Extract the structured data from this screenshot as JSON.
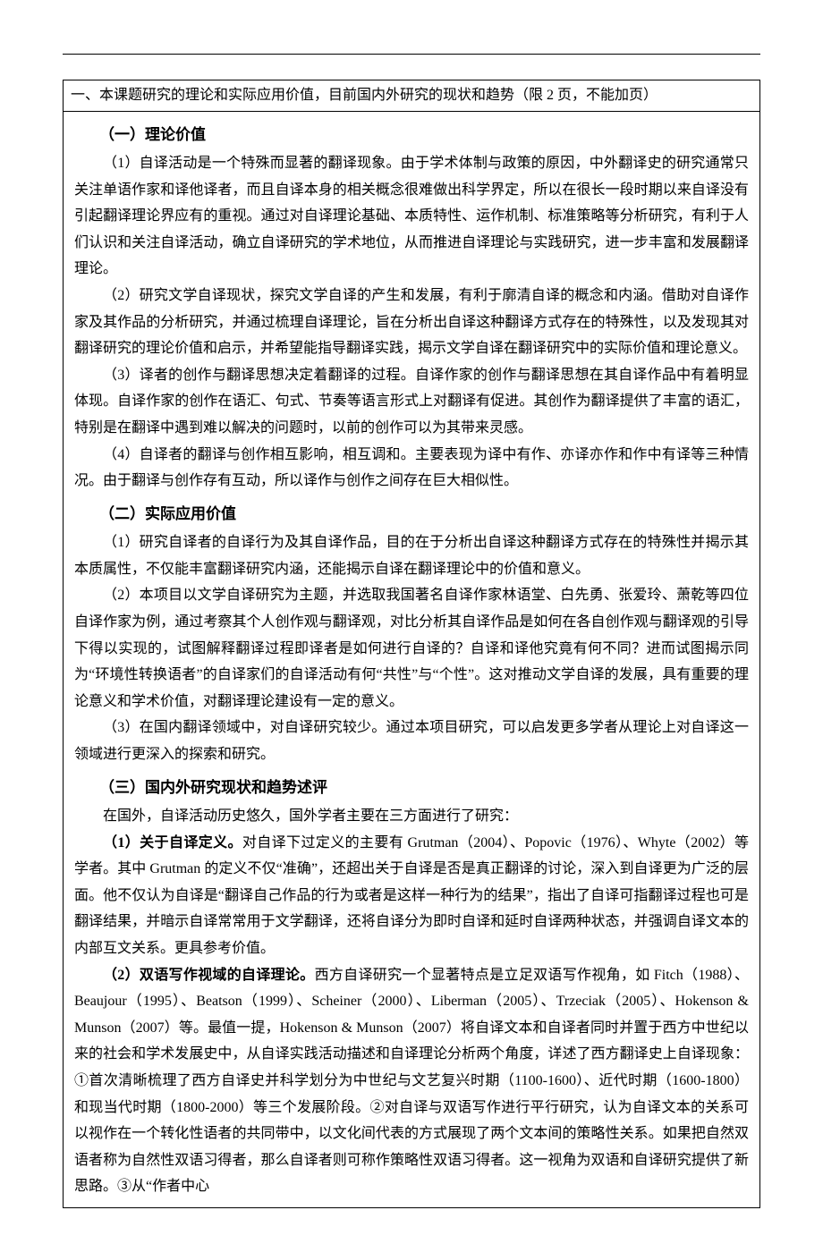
{
  "box_header": "一、本课题研究的理论和实际应用价值，目前国内外研究的现状和趋势（限 2 页，不能加页）",
  "s1": {
    "title": "（一）理论价值",
    "p1": "（1）自译活动是一个特殊而显著的翻译现象。由于学术体制与政策的原因，中外翻译史的研究通常只关注单语作家和译他译者，而且自译本身的相关概念很难做出科学界定，所以在很长一段时期以来自译没有引起翻译理论界应有的重视。通过对自译理论基础、本质特性、运作机制、标准策略等分析研究，有利于人们认识和关注自译活动，确立自译研究的学术地位，从而推进自译理论与实践研究，进一步丰富和发展翻译理论。",
    "p2": "（2）研究文学自译现状，探究文学自译的产生和发展，有利于廓清自译的概念和内涵。借助对自译作家及其作品的分析研究，并通过梳理自译理论，旨在分析出自译这种翻译方式存在的特殊性，以及发现其对翻译研究的理论价值和启示，并希望能指导翻译实践，揭示文学自译在翻译研究中的实际价值和理论意义。",
    "p3": "（3）译者的创作与翻译思想决定着翻译的过程。自译作家的创作与翻译思想在其自译作品中有着明显体现。自译作家的创作在语汇、句式、节奏等语言形式上对翻译有促进。其创作为翻译提供了丰富的语汇，特别是在翻译中遇到难以解决的问题时，以前的创作可以为其带来灵感。",
    "p4": "（4）自译者的翻译与创作相互影响，相互调和。主要表现为译中有作、亦译亦作和作中有译等三种情况。由于翻译与创作存有互动，所以译作与创作之间存在巨大相似性。"
  },
  "s2": {
    "title": "（二）实际应用价值",
    "p1": "（1）研究自译者的自译行为及其自译作品，目的在于分析出自译这种翻译方式存在的特殊性并揭示其本质属性，不仅能丰富翻译研究内涵，还能揭示自译在翻译理论中的价值和意义。",
    "p2": "（2）本项目以文学自译研究为主题，并选取我国著名自译作家林语堂、白先勇、张爱玲、萧乾等四位自译作家为例，通过考察其个人创作观与翻译观，对比分析其自译作品是如何在各自创作观与翻译观的引导下得以实现的，试图解释翻译过程即译者是如何进行自译的？自译和译他究竟有何不同？进而试图揭示同为“环境性转换语者”的自译家们的自译活动有何“共性”与“个性”。这对推动文学自译的发展，具有重要的理论意义和学术价值，对翻译理论建设有一定的意义。",
    "p3": "（3）在国内翻译领域中，对自译研究较少。通过本项目研究，可以启发更多学者从理论上对自译这一领域进行更深入的探索和研究。"
  },
  "s3": {
    "title": "（三）国内外研究现状和趋势述评",
    "intro": "在国外，自译活动历史悠久，国外学者主要在三方面进行了研究：",
    "p1_lead": "（1）关于自译定义。",
    "p1_rest": "对自译下过定义的主要有 Grutman（2004）、Popovic（1976）、Whyte（2002）等学者。其中 Grutman 的定义不仅“准确”，还超出关于自译是否是真正翻译的讨论，深入到自译更为广泛的层面。他不仅认为自译是“翻译自己作品的行为或者是这样一种行为的结果”，指出了自译可指翻译过程也可是翻译结果，并暗示自译常常用于文学翻译，还将自译分为即时自译和延时自译两种状态，并强调自译文本的内部互文关系。更具参考价值。",
    "p2_lead": "（2）双语写作视域的自译理论。",
    "p2_rest": "西方自译研究一个显著特点是立足双语写作视角，如 Fitch（1988）、Beaujour（1995）、Beatson（1999）、Scheiner（2000）、Liberman（2005）、Trzeciak（2005）、Hokenson & Munson（2007）等。最值一提，Hokenson & Munson（2007）将自译文本和自译者同时并置于西方中世纪以来的社会和学术发展史中，从自译实践活动描述和自译理论分析两个角度，详述了西方翻译史上自译现象：①首次清晰梳理了西方自译史并科学划分为中世纪与文艺复兴时期（1100-1600）、近代时期（1600-1800）和现当代时期（1800-2000）等三个发展阶段。②对自译与双语写作进行平行研究，认为自译文本的关系可以视作在一个转化性语者的共同带中，以文化间代表的方式展现了两个文本间的策略性关系。如果把自然双语者称为自然性双语习得者，那么自译者则可称作策略性双语习得者。这一视角为双语和自译研究提供了新思路。③从“作者中心"
  }
}
